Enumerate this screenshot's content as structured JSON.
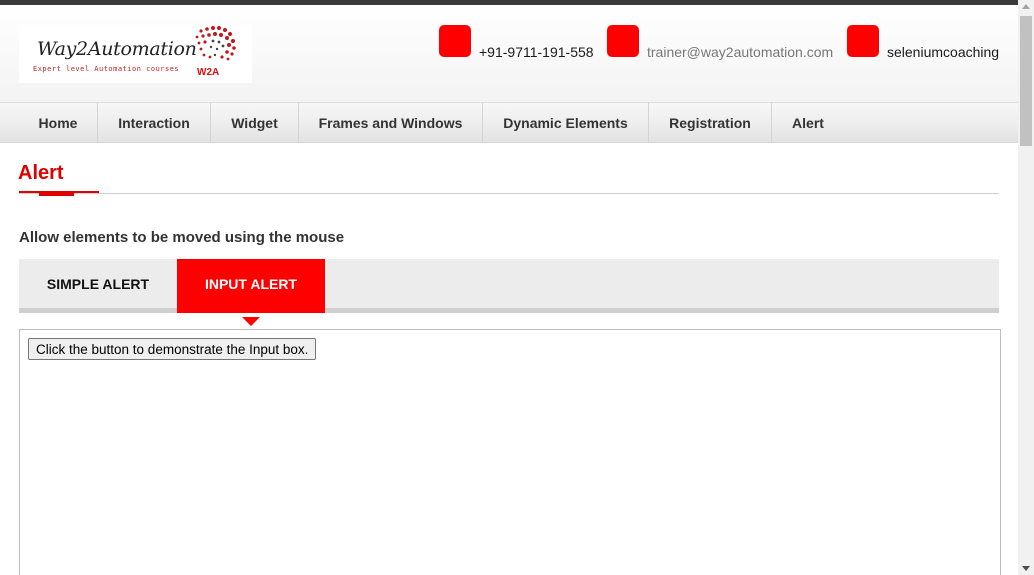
{
  "header": {
    "logo": {
      "name": "Way2Automation",
      "tagline": "Expert level Automation courses",
      "mark": "W2A"
    },
    "contacts": [
      {
        "icon": "phone-icon",
        "text": "+91-9711-191-558"
      },
      {
        "icon": "email-icon",
        "text": "trainer@way2automation.com"
      },
      {
        "icon": "skype-icon",
        "text": "seleniumcoaching"
      }
    ],
    "accent_color": "#ff0000"
  },
  "nav": {
    "items": [
      {
        "label": "Home"
      },
      {
        "label": "Interaction"
      },
      {
        "label": "Widget"
      },
      {
        "label": "Frames and Windows"
      },
      {
        "label": "Dynamic Elements"
      },
      {
        "label": "Registration"
      },
      {
        "label": "Alert"
      }
    ]
  },
  "main": {
    "title": "Alert",
    "subtitle": "Allow elements to be moved using the mouse",
    "tabs": [
      {
        "label": "SIMPLE ALERT",
        "active": false
      },
      {
        "label": "INPUT ALERT",
        "active": true
      }
    ],
    "frame": {
      "button_label": "Click the button to demonstrate the Input box."
    }
  }
}
